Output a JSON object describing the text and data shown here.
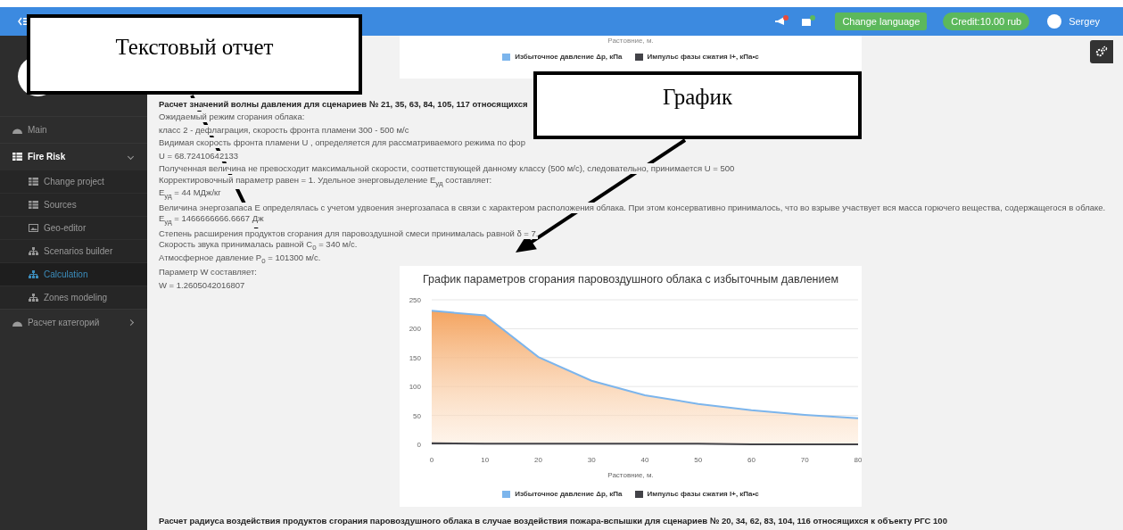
{
  "topbar": {
    "user": "Sergey",
    "buttons": [
      {
        "label": "Change language",
        "kind": "button"
      },
      {
        "label": "Credit:10.00 rub",
        "kind": "pill"
      }
    ]
  },
  "sidebar": {
    "items": [
      {
        "label": "Main",
        "kind": "dashboard",
        "selected": false
      },
      {
        "label": "Fire Risk",
        "kind": "table",
        "selected": false,
        "expanded": true,
        "children": [
          {
            "label": "Change project",
            "kind": "table",
            "selected": false
          },
          {
            "label": "Sources",
            "kind": "table",
            "selected": false
          },
          {
            "label": "Geo-editor",
            "kind": "image",
            "selected": false
          },
          {
            "label": "Scenarios builder",
            "kind": "sitemap",
            "selected": false
          },
          {
            "label": "Calculation",
            "kind": "sitemap",
            "selected": true
          },
          {
            "label": "Zones modeling",
            "kind": "sitemap",
            "selected": false
          }
        ]
      },
      {
        "label": "Расчет категорий",
        "kind": "dashboard",
        "selected": false,
        "expanded": false
      }
    ]
  },
  "previous_chart": {
    "xlabel": "Растовние, м.",
    "legend": [
      {
        "label": "Избыточное давление Δp, кПа",
        "color": "#7cb5ec"
      },
      {
        "label": "Импульс фазы сжатия I+, кПа•с",
        "color": "#434348"
      }
    ]
  },
  "report": {
    "heading": "Расчет значений волны давления для сценариев № 21, 35, 63, 84, 105, 117 относящихся",
    "lines": [
      "Ожидаемый режим сгорания облака:",
      "класс 2 - дефлаграция, скорость фронта пламени 300 - 500 м/с",
      "Видимая скорость фронта пламени U , определяется для рассматриваемого режима по фор",
      "U = 68.72410642133",
      "Полученная величина не превосходит максимальной скорости, соответствующей данному классу (500 м/с), следовательно, принимается U = 500",
      "Корректировочный параметр равен = 1. Удельное энерговыделение E$_{уд}$ составляет:",
      "E$_{уд}$ = 44 МДж/кг",
      "Величина энергозапаса E определялась с учетом удвоения энергозапаса в связи с характером расположения облака. При этом консервативно принималось, что во взрыве участвует вся масса горючего вещества, содержащегося в облаке.",
      "E$_{уд}$ = 1466666666.6667 Дж",
      "Степень расширения продуктов сгорания для паровоздушной смеси принималась равной δ = 7.",
      "Скорость звука принималась равной C$_{0}$ = 340 м/с.",
      "Атмосферное давление P$_{0}$ = 101300 м/с.",
      "Параметр W составляет:",
      "W = 1.2605042016807"
    ]
  },
  "chart": {
    "chart_data": {
      "type": "area",
      "title": "График параметров сгорания паровоздушного облака с избыточным давлением",
      "xlabel": "Растовние, м.",
      "x": [
        0,
        10,
        20,
        30,
        40,
        50,
        60,
        70,
        80
      ],
      "series": [
        {
          "name": "Избыточное давление Δp, кПа",
          "color": "#7cb5ec",
          "values": [
            231,
            223,
            151,
            110,
            85,
            70,
            59,
            51,
            45
          ]
        },
        {
          "name": "Импульс фазы сжатия I+, кПа•с",
          "color": "#434348",
          "values": [
            2,
            1,
            1,
            1,
            1,
            1,
            0,
            0,
            0
          ]
        }
      ],
      "xlim": [
        0,
        80
      ],
      "ylim": [
        0,
        250
      ],
      "xticks": [
        0,
        10,
        20,
        30,
        40,
        50,
        60,
        70,
        80
      ],
      "yticks": [
        0,
        50,
        100,
        150,
        200,
        250
      ],
      "grid": true,
      "legend": true
    }
  },
  "next_heading": "Расчет радиуса воздействия продуктов сгорания паровоздушного облака в случае воздействия пожара-вспышки для сценариев № 20, 34, 62, 83, 104, 116 относящихся к объекту РГС 100",
  "callouts": [
    {
      "text": "Текстовый отчет"
    },
    {
      "text": "График"
    }
  ]
}
